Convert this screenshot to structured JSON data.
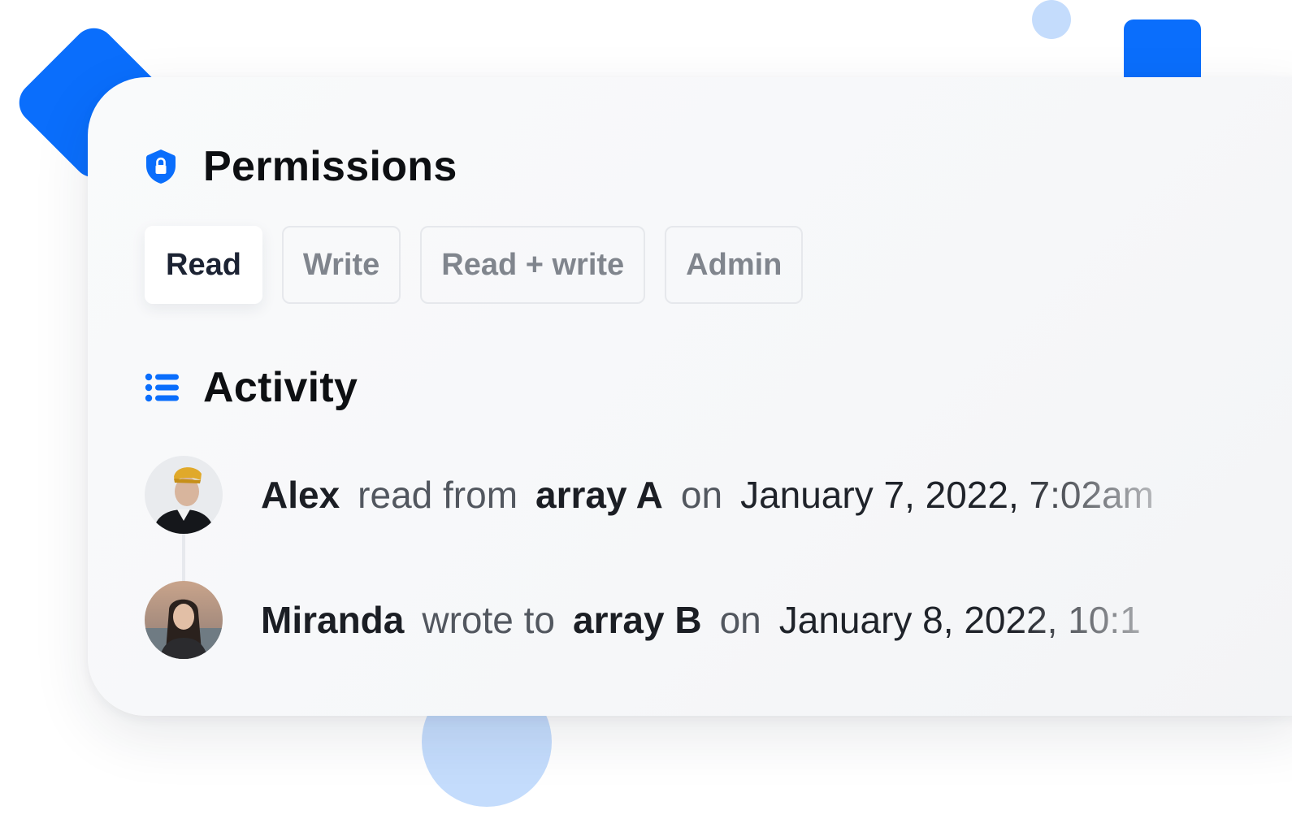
{
  "permissions": {
    "title": "Permissions",
    "icon": "shield-lock-icon",
    "tabs": [
      {
        "label": "Read",
        "active": true
      },
      {
        "label": "Write",
        "active": false
      },
      {
        "label": "Read + write",
        "active": false
      },
      {
        "label": "Admin",
        "active": false
      }
    ]
  },
  "activity": {
    "title": "Activity",
    "icon": "list-icon",
    "items": [
      {
        "user": "Alex",
        "action": "read from",
        "target": "array A",
        "preposition": "on",
        "datetime": "January 7, 2022, 7:02am",
        "avatar": "avatar-alex"
      },
      {
        "user": "Miranda",
        "action": "wrote to",
        "target": "array B",
        "preposition": "on",
        "datetime": "January 8, 2022, 10:1",
        "avatar": "avatar-miranda"
      }
    ]
  },
  "colors": {
    "accent": "#0a6efc",
    "accent_light": "#c4dcfc",
    "text_dark": "#0d0f12",
    "text_muted": "#80858d"
  }
}
